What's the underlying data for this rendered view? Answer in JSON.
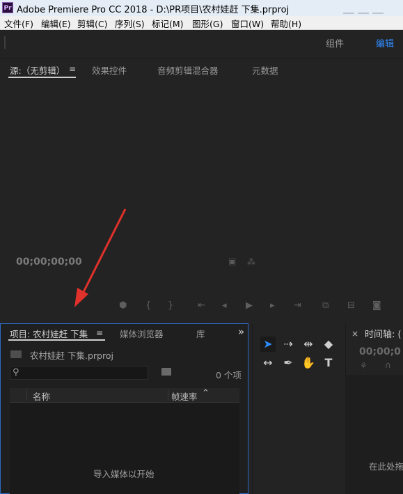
{
  "window": {
    "app_icon": "Pr",
    "title": "Adobe Premiere Pro CC 2018 - D:\\PR项目\\农村娃赶 下集.prproj"
  },
  "menu": [
    "文件(F)",
    "编辑(E)",
    "剪辑(C)",
    "序列(S)",
    "标记(M)",
    "图形(G)",
    "窗口(W)",
    "帮助(H)"
  ],
  "workspaces": {
    "items": [
      "组件",
      "编辑"
    ],
    "active": "编辑",
    "active_color": "#2f8cff"
  },
  "source_panel": {
    "tabs": [
      "源:（无剪辑）",
      "效果控件",
      "音频剪辑混合器",
      "元数据"
    ],
    "menu_icon": "≡",
    "timecode": "00;00;00;00"
  },
  "project_panel": {
    "tabs": [
      "项目: 农村娃赶 下集",
      "媒体浏览器",
      "库"
    ],
    "menu_icon": "≡",
    "overflow_icon": "»",
    "file_name": "农村娃赶 下集.prproj",
    "search_placeholder": "",
    "item_count": "0 个项",
    "columns": {
      "name": "名称",
      "frame_rate": "帧速率"
    },
    "empty_hint": "导入媒体以开始"
  },
  "timeline_panel": {
    "close_icon": "×",
    "title": "时间轴: (",
    "timecode": "00;00;0",
    "drop_hint": "在此处拖"
  },
  "colors": {
    "accent": "#2f8cff",
    "annotation_arrow": "#e0312b",
    "panel_focus": "#2d6bc7"
  }
}
